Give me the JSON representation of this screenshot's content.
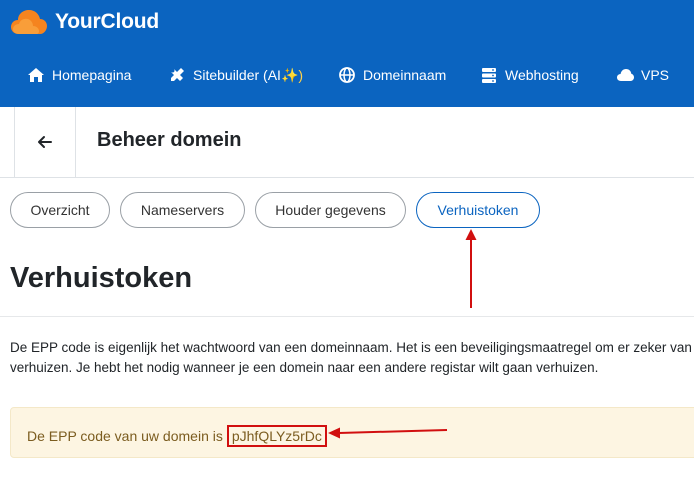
{
  "brand": {
    "name": "YourCloud"
  },
  "nav": {
    "items": [
      {
        "label": "Homepagina",
        "icon": "home-icon"
      },
      {
        "label": "Sitebuilder (AI",
        "suffix": "✨)",
        "icon": "tools-icon"
      },
      {
        "label": "Domeinnaam",
        "icon": "globe-icon"
      },
      {
        "label": "Webhosting",
        "icon": "server-icon"
      },
      {
        "label": "VPS",
        "icon": "cloud-icon"
      }
    ]
  },
  "header": {
    "title": "Beheer domein",
    "back_icon": "arrow-left-icon"
  },
  "tabs": [
    {
      "label": "Overzicht",
      "active": false
    },
    {
      "label": "Nameservers",
      "active": false
    },
    {
      "label": "Houder gegevens",
      "active": false
    },
    {
      "label": "Verhuistoken",
      "active": true
    }
  ],
  "content": {
    "heading": "Verhuistoken",
    "description_line1": "De EPP code is eigenlijk het wachtwoord van een domeinnaam. Het is een beveiligingsmaatregel om er zeker van",
    "description_line2": "verhuizen. Je hebt het nodig wanneer je een domein naar een andere registar wilt gaan verhuizen.",
    "alert_text": "De EPP code van uw domein is",
    "epp_code": "pJhfQLYz5rDc"
  },
  "colors": {
    "brand_blue": "#0b64c0",
    "logo_orange": "#f5841f",
    "alert_bg": "#fdf5e2",
    "alert_text": "#7b5c1f",
    "annotation_red": "#d10f0f"
  }
}
